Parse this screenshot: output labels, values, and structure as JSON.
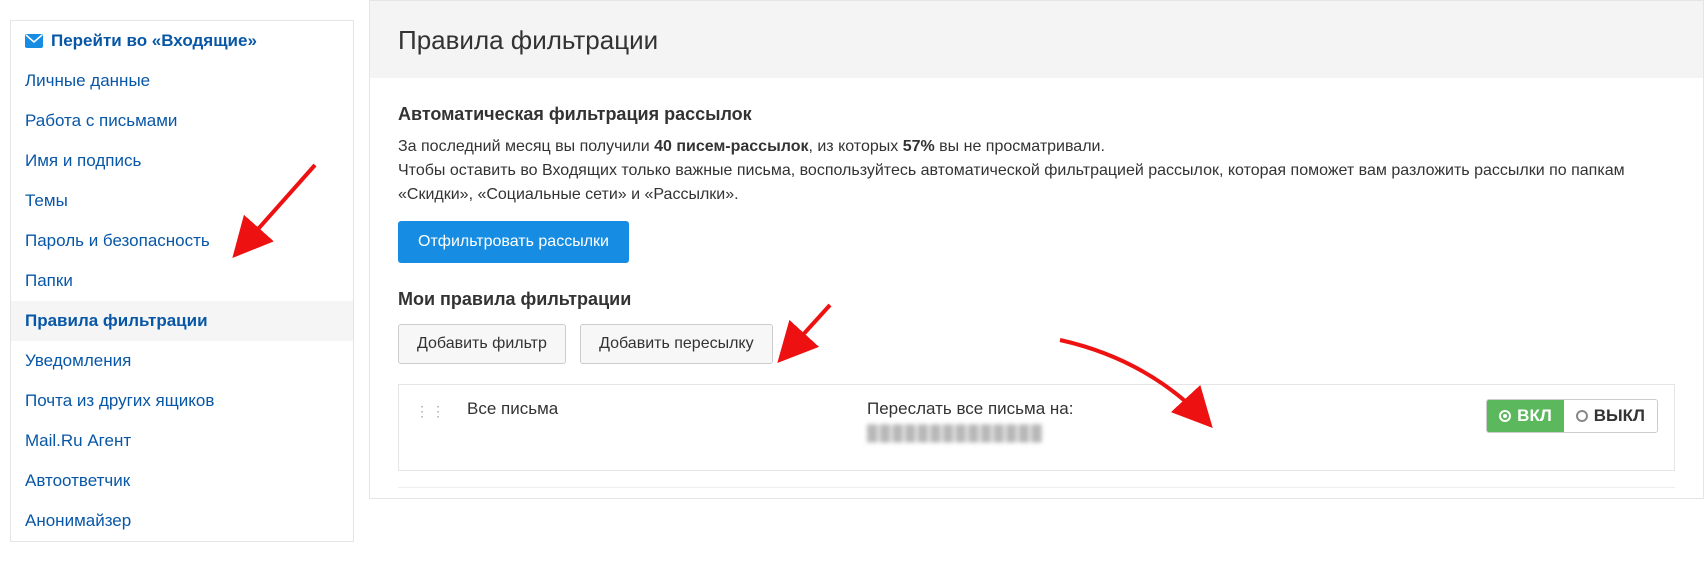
{
  "sidebar": {
    "items": [
      {
        "label": "Перейти во «Входящие»",
        "bold": true,
        "icon": "mail-icon"
      },
      {
        "label": "Личные данные"
      },
      {
        "label": "Работа с письмами"
      },
      {
        "label": "Имя и подпись"
      },
      {
        "label": "Темы"
      },
      {
        "label": "Пароль и безопасность"
      },
      {
        "label": "Папки"
      },
      {
        "label": "Правила фильтрации",
        "active": true
      },
      {
        "label": "Уведомления"
      },
      {
        "label": "Почта из других ящиков"
      },
      {
        "label": "Mail.Ru Агент"
      },
      {
        "label": "Автоответчик"
      },
      {
        "label": "Анонимайзер"
      }
    ]
  },
  "main": {
    "title": "Правила фильтрации",
    "auto_heading": "Автоматическая фильтрация рассылок",
    "auto_text_pre": "За последний месяц вы получили ",
    "auto_text_count": "40 писем-рассылок",
    "auto_text_mid": ", из которых ",
    "auto_text_percent": "57%",
    "auto_text_post": " вы не просматривали.",
    "auto_text_line2": "Чтобы оставить во Входящих только важные письма, воспользуйтесь автоматической фильтрацией рассылок, которая поможет вам разложить рассылки по папкам «Скидки», «Социальные сети» и «Рассылки».",
    "filter_button": "Отфильтровать рассылки",
    "my_rules_heading": "Мои правила фильтрации",
    "add_filter": "Добавить фильтр",
    "add_forward": "Добавить пересылку",
    "rule": {
      "col1": "Все письма",
      "forward_label": "Переслать все письма на:",
      "forward_email": "██████████████",
      "toggle_on": "ВКЛ",
      "toggle_off": "ВЫКЛ"
    }
  }
}
